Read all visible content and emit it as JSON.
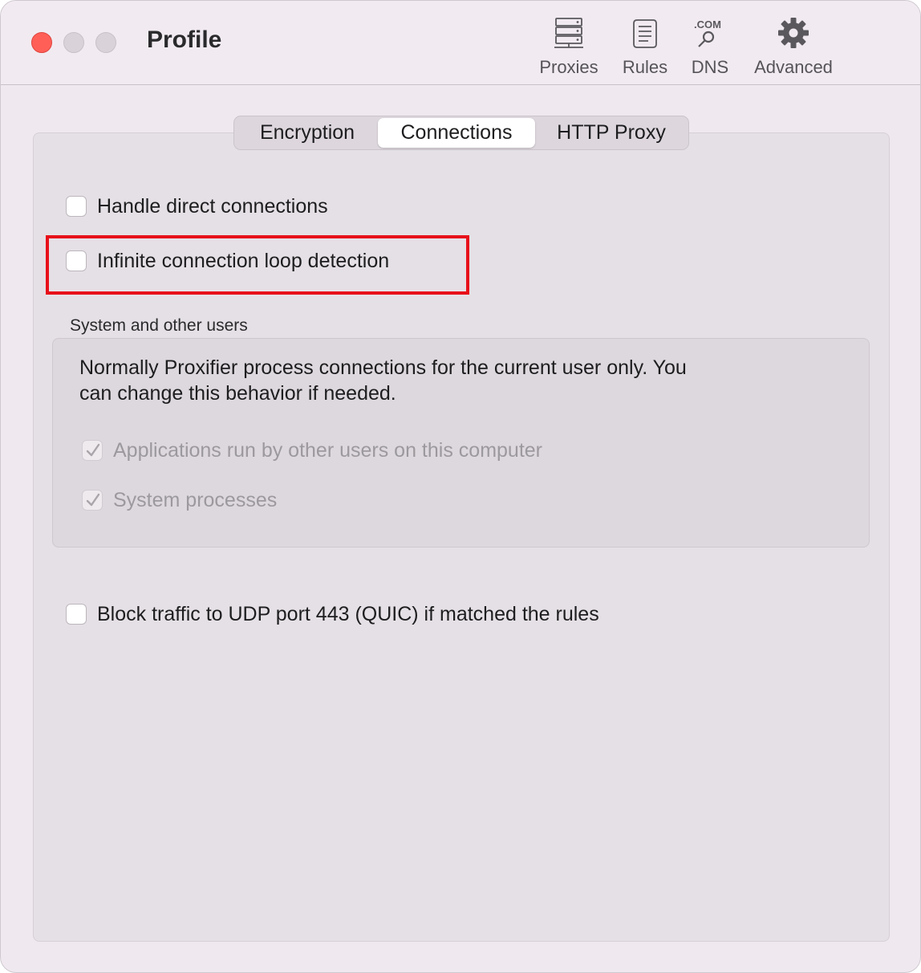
{
  "window": {
    "title": "Profile"
  },
  "toolbar": {
    "items": [
      {
        "label": "Proxies",
        "icon": "server-icon"
      },
      {
        "label": "Rules",
        "icon": "document-list-icon"
      },
      {
        "label": "DNS",
        "icon": "dns-magnifier-icon",
        "icon_text": ".COM"
      },
      {
        "label": "Advanced",
        "icon": "gear-icon"
      }
    ]
  },
  "tabs": [
    {
      "label": "Encryption",
      "selected": false
    },
    {
      "label": "Connections",
      "selected": true
    },
    {
      "label": "HTTP Proxy",
      "selected": false
    }
  ],
  "options": {
    "handle_direct": {
      "label": "Handle direct connections",
      "checked": false
    },
    "loop_detection": {
      "label": "Infinite connection loop detection",
      "checked": false
    },
    "block_quic": {
      "label": "Block traffic to UDP port 443 (QUIC) if matched the rules",
      "checked": false
    }
  },
  "system_group": {
    "title": "System and other users",
    "description": "Normally Proxifier process connections for the current user only. You can change this behavior if needed.",
    "other_users": {
      "label": "Applications run by other users on this computer",
      "checked": true,
      "enabled": false
    },
    "system_processes": {
      "label": "System processes",
      "checked": true,
      "enabled": false
    }
  },
  "colors": {
    "highlight_box": "#e8101a",
    "close_button": "#ff5f57"
  }
}
